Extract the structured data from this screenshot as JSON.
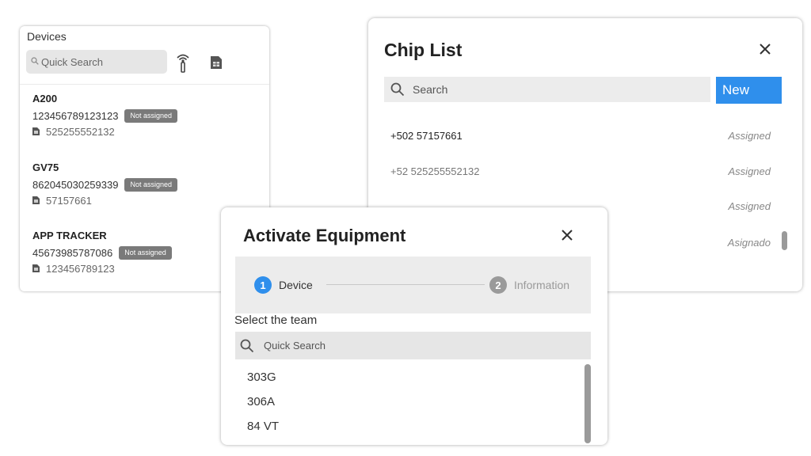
{
  "devices_panel": {
    "title": "Devices",
    "search_placeholder": "Quick Search",
    "items": [
      {
        "name": "A200",
        "imei": "123456789123123",
        "status": "Not assigned",
        "sim": "525255552132"
      },
      {
        "name": "GV75",
        "imei": "862045030259339",
        "status": "Not assigned",
        "sim": "57157661"
      },
      {
        "name": "APP TRACKER",
        "imei": "45673985787086",
        "status": "Not assigned",
        "sim": "123456789123"
      }
    ]
  },
  "chip_list": {
    "title": "Chip List",
    "search_placeholder": "Search",
    "new_label": "New",
    "rows": [
      {
        "number": "+502 57157661",
        "status": "Assigned"
      },
      {
        "number": "+52 525255552132",
        "status": "Assigned"
      },
      {
        "number": "",
        "status": "Assigned"
      },
      {
        "number": "",
        "status": "Asignado"
      }
    ]
  },
  "activate_dialog": {
    "title": "Activate Equipment",
    "steps": [
      {
        "number": "1",
        "label": "Device",
        "active": true
      },
      {
        "number": "2",
        "label": "Information",
        "active": false
      }
    ],
    "select_label": "Select the team",
    "search_placeholder": "Quick Search",
    "teams": [
      "303G",
      "306A",
      "84 VT"
    ]
  },
  "colors": {
    "accent": "#2f8fec",
    "badge": "#7a7a7a",
    "panel_bg": "#ffffff",
    "input_bg": "#e6e6e6"
  },
  "icons": [
    "search-icon",
    "tower-icon",
    "sim-card-icon",
    "close-icon"
  ]
}
